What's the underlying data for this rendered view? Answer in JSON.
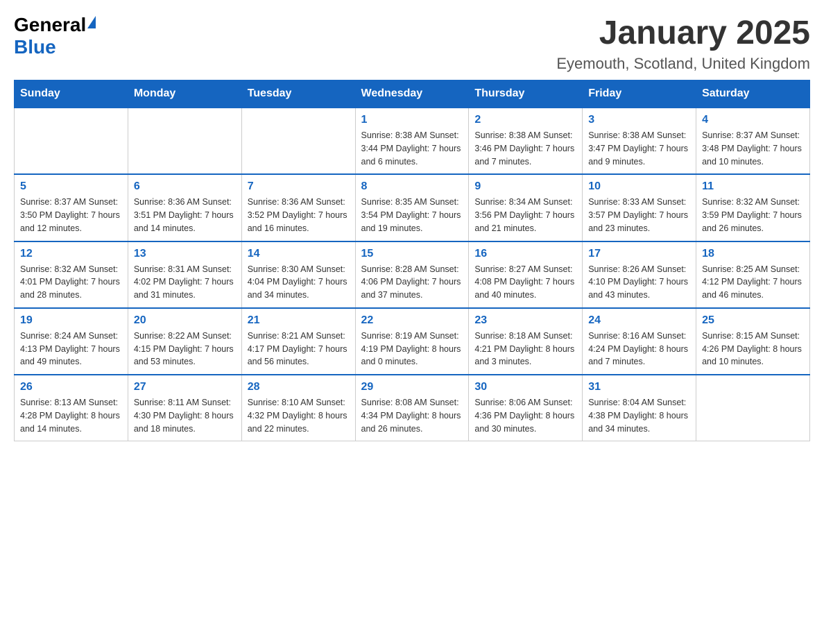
{
  "logo": {
    "general": "General",
    "blue": "Blue"
  },
  "title": "January 2025",
  "subtitle": "Eyemouth, Scotland, United Kingdom",
  "days_of_week": [
    "Sunday",
    "Monday",
    "Tuesday",
    "Wednesday",
    "Thursday",
    "Friday",
    "Saturday"
  ],
  "weeks": [
    [
      {
        "day": "",
        "info": ""
      },
      {
        "day": "",
        "info": ""
      },
      {
        "day": "",
        "info": ""
      },
      {
        "day": "1",
        "info": "Sunrise: 8:38 AM\nSunset: 3:44 PM\nDaylight: 7 hours and 6 minutes."
      },
      {
        "day": "2",
        "info": "Sunrise: 8:38 AM\nSunset: 3:46 PM\nDaylight: 7 hours and 7 minutes."
      },
      {
        "day": "3",
        "info": "Sunrise: 8:38 AM\nSunset: 3:47 PM\nDaylight: 7 hours and 9 minutes."
      },
      {
        "day": "4",
        "info": "Sunrise: 8:37 AM\nSunset: 3:48 PM\nDaylight: 7 hours and 10 minutes."
      }
    ],
    [
      {
        "day": "5",
        "info": "Sunrise: 8:37 AM\nSunset: 3:50 PM\nDaylight: 7 hours and 12 minutes."
      },
      {
        "day": "6",
        "info": "Sunrise: 8:36 AM\nSunset: 3:51 PM\nDaylight: 7 hours and 14 minutes."
      },
      {
        "day": "7",
        "info": "Sunrise: 8:36 AM\nSunset: 3:52 PM\nDaylight: 7 hours and 16 minutes."
      },
      {
        "day": "8",
        "info": "Sunrise: 8:35 AM\nSunset: 3:54 PM\nDaylight: 7 hours and 19 minutes."
      },
      {
        "day": "9",
        "info": "Sunrise: 8:34 AM\nSunset: 3:56 PM\nDaylight: 7 hours and 21 minutes."
      },
      {
        "day": "10",
        "info": "Sunrise: 8:33 AM\nSunset: 3:57 PM\nDaylight: 7 hours and 23 minutes."
      },
      {
        "day": "11",
        "info": "Sunrise: 8:32 AM\nSunset: 3:59 PM\nDaylight: 7 hours and 26 minutes."
      }
    ],
    [
      {
        "day": "12",
        "info": "Sunrise: 8:32 AM\nSunset: 4:01 PM\nDaylight: 7 hours and 28 minutes."
      },
      {
        "day": "13",
        "info": "Sunrise: 8:31 AM\nSunset: 4:02 PM\nDaylight: 7 hours and 31 minutes."
      },
      {
        "day": "14",
        "info": "Sunrise: 8:30 AM\nSunset: 4:04 PM\nDaylight: 7 hours and 34 minutes."
      },
      {
        "day": "15",
        "info": "Sunrise: 8:28 AM\nSunset: 4:06 PM\nDaylight: 7 hours and 37 minutes."
      },
      {
        "day": "16",
        "info": "Sunrise: 8:27 AM\nSunset: 4:08 PM\nDaylight: 7 hours and 40 minutes."
      },
      {
        "day": "17",
        "info": "Sunrise: 8:26 AM\nSunset: 4:10 PM\nDaylight: 7 hours and 43 minutes."
      },
      {
        "day": "18",
        "info": "Sunrise: 8:25 AM\nSunset: 4:12 PM\nDaylight: 7 hours and 46 minutes."
      }
    ],
    [
      {
        "day": "19",
        "info": "Sunrise: 8:24 AM\nSunset: 4:13 PM\nDaylight: 7 hours and 49 minutes."
      },
      {
        "day": "20",
        "info": "Sunrise: 8:22 AM\nSunset: 4:15 PM\nDaylight: 7 hours and 53 minutes."
      },
      {
        "day": "21",
        "info": "Sunrise: 8:21 AM\nSunset: 4:17 PM\nDaylight: 7 hours and 56 minutes."
      },
      {
        "day": "22",
        "info": "Sunrise: 8:19 AM\nSunset: 4:19 PM\nDaylight: 8 hours and 0 minutes."
      },
      {
        "day": "23",
        "info": "Sunrise: 8:18 AM\nSunset: 4:21 PM\nDaylight: 8 hours and 3 minutes."
      },
      {
        "day": "24",
        "info": "Sunrise: 8:16 AM\nSunset: 4:24 PM\nDaylight: 8 hours and 7 minutes."
      },
      {
        "day": "25",
        "info": "Sunrise: 8:15 AM\nSunset: 4:26 PM\nDaylight: 8 hours and 10 minutes."
      }
    ],
    [
      {
        "day": "26",
        "info": "Sunrise: 8:13 AM\nSunset: 4:28 PM\nDaylight: 8 hours and 14 minutes."
      },
      {
        "day": "27",
        "info": "Sunrise: 8:11 AM\nSunset: 4:30 PM\nDaylight: 8 hours and 18 minutes."
      },
      {
        "day": "28",
        "info": "Sunrise: 8:10 AM\nSunset: 4:32 PM\nDaylight: 8 hours and 22 minutes."
      },
      {
        "day": "29",
        "info": "Sunrise: 8:08 AM\nSunset: 4:34 PM\nDaylight: 8 hours and 26 minutes."
      },
      {
        "day": "30",
        "info": "Sunrise: 8:06 AM\nSunset: 4:36 PM\nDaylight: 8 hours and 30 minutes."
      },
      {
        "day": "31",
        "info": "Sunrise: 8:04 AM\nSunset: 4:38 PM\nDaylight: 8 hours and 34 minutes."
      },
      {
        "day": "",
        "info": ""
      }
    ]
  ]
}
